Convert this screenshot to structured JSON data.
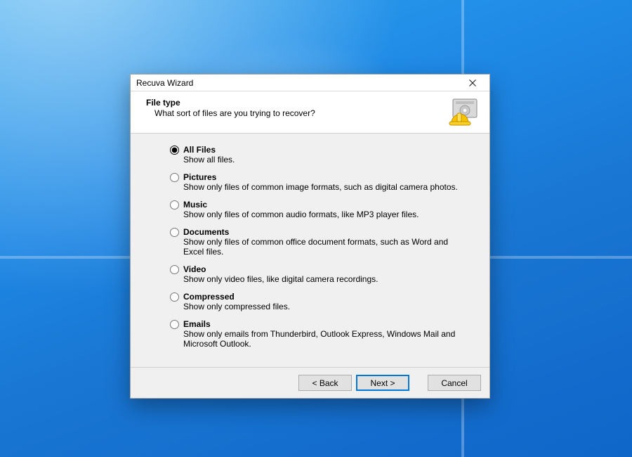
{
  "window": {
    "title": "Recuva Wizard"
  },
  "header": {
    "title": "File type",
    "subtitle": "What sort of files are you trying to recover?"
  },
  "options": [
    {
      "id": "all",
      "label": "All Files",
      "desc": "Show all files."
    },
    {
      "id": "pictures",
      "label": "Pictures",
      "desc": "Show only files of common image formats, such as digital camera photos."
    },
    {
      "id": "music",
      "label": "Music",
      "desc": "Show only files of common audio formats, like MP3 player files."
    },
    {
      "id": "documents",
      "label": "Documents",
      "desc": "Show only files of common office document formats, such as Word and Excel files."
    },
    {
      "id": "video",
      "label": "Video",
      "desc": "Show only video files, like digital camera recordings."
    },
    {
      "id": "compressed",
      "label": "Compressed",
      "desc": "Show only compressed files."
    },
    {
      "id": "emails",
      "label": "Emails",
      "desc": "Show only emails from Thunderbird, Outlook Express, Windows Mail and Microsoft Outlook."
    }
  ],
  "selected_option": "all",
  "buttons": {
    "back": "< Back",
    "next": "Next >",
    "cancel": "Cancel"
  }
}
